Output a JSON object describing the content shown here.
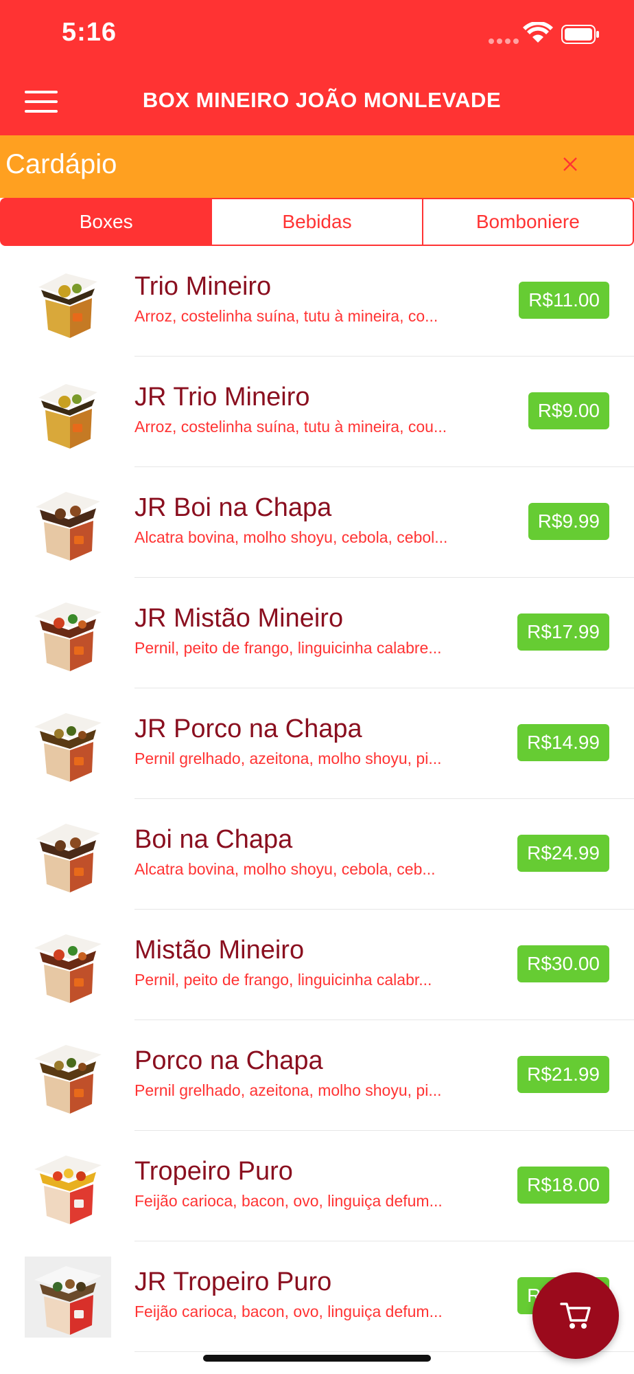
{
  "status_bar": {
    "time": "5:16"
  },
  "nav": {
    "title": "BOX MINEIRO JOÃO MONLEVADE"
  },
  "section": {
    "title": "Cardápio"
  },
  "tabs": [
    {
      "label": "Boxes",
      "active": true
    },
    {
      "label": "Bebidas",
      "active": false
    },
    {
      "label": "Bomboniere",
      "active": false
    }
  ],
  "items": [
    {
      "name": "Trio Mineiro",
      "description": "Arroz, costelinha suína, tutu à mineira, co...",
      "price": "R$11.00",
      "image": "box-trio-icon"
    },
    {
      "name": "JR Trio Mineiro",
      "description": "Arroz, costelinha suína, tutu à mineira, cou...",
      "price": "R$9.00",
      "image": "box-trio-icon"
    },
    {
      "name": "JR Boi na Chapa",
      "description": "Alcatra bovina, molho shoyu, cebola, cebol...",
      "price": "R$9.99",
      "image": "box-beef-icon"
    },
    {
      "name": "JR Mistão Mineiro",
      "description": "Pernil, peito de frango, linguicinha calabre...",
      "price": "R$17.99",
      "image": "box-mixed-icon"
    },
    {
      "name": "JR Porco na Chapa",
      "description": "Pernil grelhado, azeitona, molho shoyu, pi...",
      "price": "R$14.99",
      "image": "box-pork-icon"
    },
    {
      "name": "Boi na Chapa",
      "description": "Alcatra bovina, molho shoyu, cebola, ceb...",
      "price": "R$24.99",
      "image": "box-beef-icon"
    },
    {
      "name": "Mistão Mineiro",
      "description": "Pernil, peito de frango, linguicinha calabr...",
      "price": "R$30.00",
      "image": "box-mixed-icon"
    },
    {
      "name": "Porco na Chapa",
      "description": "Pernil grelhado, azeitona, molho shoyu, pi...",
      "price": "R$21.99",
      "image": "box-pork-icon"
    },
    {
      "name": "Tropeiro Puro",
      "description": "Feijão carioca, bacon, ovo, linguiça defum...",
      "price": "R$18.00",
      "image": "box-tropeiro-icon"
    },
    {
      "name": "JR Tropeiro Puro",
      "description": "Feijão carioca, bacon, ovo, linguiça defum...",
      "price": "R$16.00",
      "image": "box-tropeiro-icon"
    }
  ],
  "colors": {
    "primary_red": "#ff3333",
    "header_orange": "#ffa020",
    "price_green": "#66cc33",
    "item_name": "#8a0f1f",
    "cart_button": "#9b0a1c"
  }
}
